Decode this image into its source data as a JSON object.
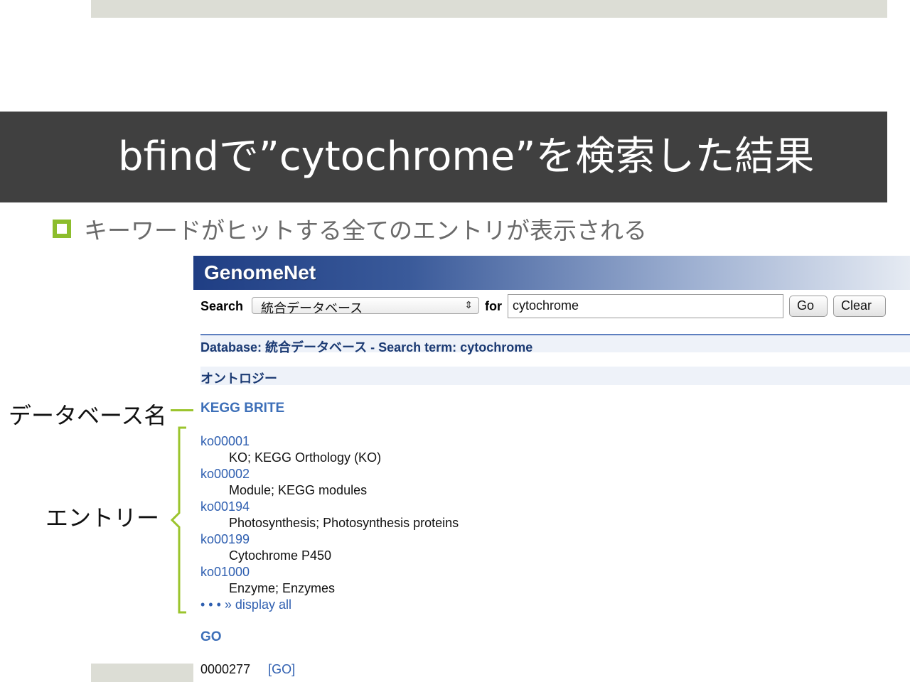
{
  "slide": {
    "title": "bfindで”cytochrome”を検索した結果",
    "bullet": "キーワードがヒットする全てのエントリが表示される",
    "annotations": {
      "database_name": "データベース名",
      "entry": "エントリー"
    },
    "colors": {
      "accent": "#8cbd2c",
      "title_bar": "#404040"
    }
  },
  "genomenet": {
    "logo": "GenomeNet",
    "search": {
      "label": "Search",
      "database_selected": "統合データベース",
      "for_label": "for",
      "term_value": "cytochrome",
      "go_button": "Go",
      "clear_button": "Clear"
    },
    "result_line": "Database: 統合データベース   -   Search term: cytochrome",
    "section": "オントロジー",
    "databases": [
      {
        "name": "KEGG BRITE",
        "entries": [
          {
            "id": "ko00001",
            "desc": "KO; KEGG Orthology (KO)"
          },
          {
            "id": "ko00002",
            "desc": "Module; KEGG modules"
          },
          {
            "id": "ko00194",
            "desc": "Photosynthesis; Photosynthesis proteins"
          },
          {
            "id": "ko00199",
            "desc": "Cytochrome P450"
          },
          {
            "id": "ko01000",
            "desc": "Enzyme; Enzymes"
          }
        ],
        "display_all": "• • • » display all"
      },
      {
        "name": "GO",
        "first_entry": {
          "id": "0000277",
          "tag": "[GO]"
        }
      }
    ]
  }
}
